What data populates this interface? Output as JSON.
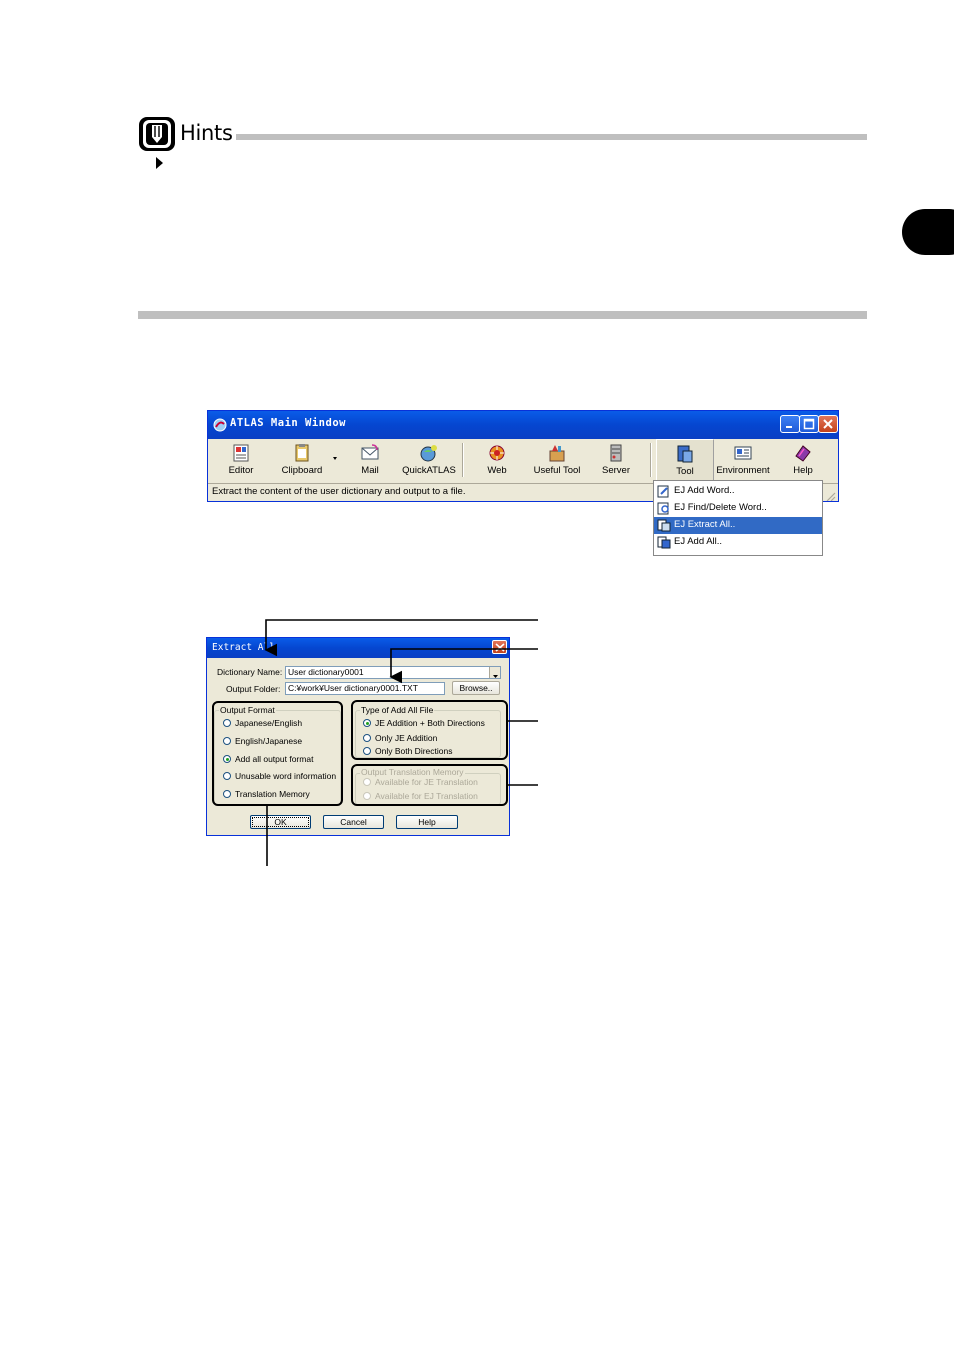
{
  "hints": {
    "title": "Hints"
  },
  "main_window": {
    "title": "ATLAS Main Window",
    "tools": [
      {
        "label": "Editor",
        "icon": "editor-icon"
      },
      {
        "label": "Clipboard",
        "icon": "clipboard-icon"
      },
      {
        "label": "Mail",
        "icon": "mail-icon"
      },
      {
        "label": "QuickATLAS",
        "icon": "quickatlas-icon"
      },
      {
        "label": "Web",
        "icon": "web-icon"
      },
      {
        "label": "Useful Tool",
        "icon": "useful-tool-icon"
      },
      {
        "label": "Server",
        "icon": "server-icon"
      },
      {
        "label": "Tool",
        "icon": "tool-icon"
      },
      {
        "label": "Environment",
        "icon": "environment-icon"
      },
      {
        "label": "Help",
        "icon": "help-icon"
      }
    ],
    "status": "Extract the content of the user dictionary and output to a file."
  },
  "menu": {
    "items": [
      "EJ Add Word..",
      "EJ Find/Delete Word..",
      "EJ Extract All..",
      "EJ Add All.."
    ],
    "selected_index": 2
  },
  "dialog": {
    "title": "Extract All",
    "dictionary_name_label": "Dictionary Name:",
    "dictionary_name_value": "User dictionary0001",
    "output_folder_label": "Output Folder:",
    "output_folder_value": "C:¥work¥User dictionary0001.TXT",
    "browse_label": "Browse..",
    "output_format": {
      "label": "Output Format",
      "options": [
        "Japanese/English",
        "English/Japanese",
        "Add all output format",
        "Unusable word information",
        "Translation Memory"
      ],
      "selected_index": 2
    },
    "add_all_type": {
      "label": "Type of Add All File",
      "options": [
        "JE Addition + Both Directions",
        "Only JE Addition",
        "Only Both Directions"
      ],
      "selected_index": 0
    },
    "translation_memory": {
      "label": "Output Translation Memory",
      "options": [
        "Available for JE Translation",
        "Available for EJ Translation"
      ]
    },
    "ok_label": "OK",
    "cancel_label": "Cancel",
    "help_label": "Help"
  },
  "colors": {
    "title_bar": "#0546d0",
    "dialog_face": "#ece9d8",
    "menu_highlight": "#316ac5",
    "rule_gray": "#bfbfbf"
  }
}
